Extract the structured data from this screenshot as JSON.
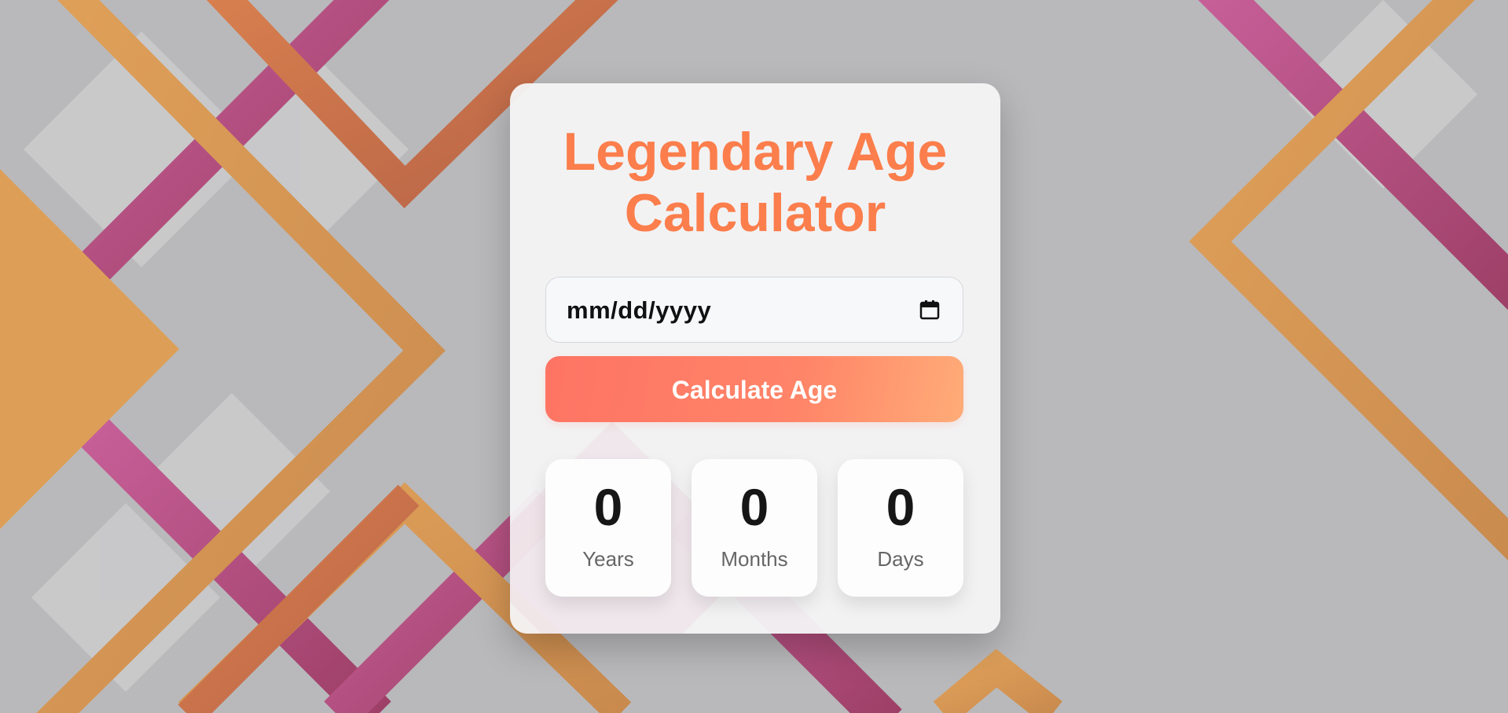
{
  "page": {
    "title": "Legendary Age Calculator"
  },
  "form": {
    "date_placeholder": "mm/dd/yyyy",
    "date_value": "",
    "calendar_icon": "calendar-icon",
    "calculate_label": "Calculate Age"
  },
  "results": [
    {
      "value": "0",
      "label": "Years"
    },
    {
      "value": "0",
      "label": "Months"
    },
    {
      "value": "0",
      "label": "Days"
    }
  ],
  "colors": {
    "title": "#fb7e4c",
    "button_start": "#fe7464",
    "button_end": "#ffac78",
    "background": "#b9b9bb",
    "stripe_orange": "#d9a05a",
    "stripe_pink": "#b5517f"
  }
}
